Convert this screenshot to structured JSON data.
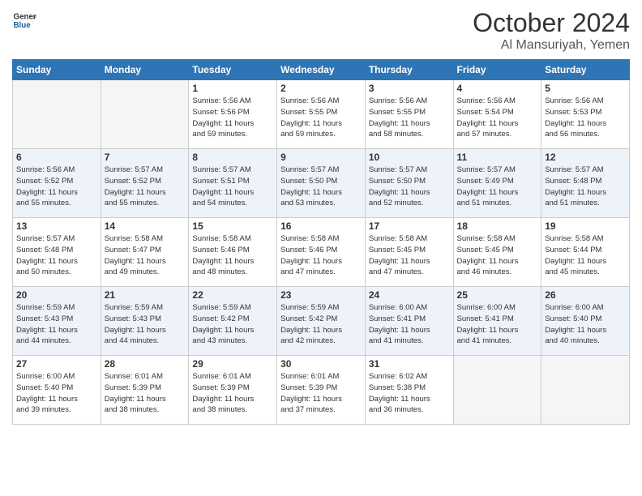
{
  "header": {
    "logo_line1": "General",
    "logo_line2": "Blue",
    "month": "October 2024",
    "location": "Al Mansuriyah, Yemen"
  },
  "weekdays": [
    "Sunday",
    "Monday",
    "Tuesday",
    "Wednesday",
    "Thursday",
    "Friday",
    "Saturday"
  ],
  "weeks": [
    [
      {
        "day": "",
        "info": ""
      },
      {
        "day": "",
        "info": ""
      },
      {
        "day": "1",
        "info": "Sunrise: 5:56 AM\nSunset: 5:56 PM\nDaylight: 11 hours\nand 59 minutes."
      },
      {
        "day": "2",
        "info": "Sunrise: 5:56 AM\nSunset: 5:55 PM\nDaylight: 11 hours\nand 59 minutes."
      },
      {
        "day": "3",
        "info": "Sunrise: 5:56 AM\nSunset: 5:55 PM\nDaylight: 11 hours\nand 58 minutes."
      },
      {
        "day": "4",
        "info": "Sunrise: 5:56 AM\nSunset: 5:54 PM\nDaylight: 11 hours\nand 57 minutes."
      },
      {
        "day": "5",
        "info": "Sunrise: 5:56 AM\nSunset: 5:53 PM\nDaylight: 11 hours\nand 56 minutes."
      }
    ],
    [
      {
        "day": "6",
        "info": "Sunrise: 5:56 AM\nSunset: 5:52 PM\nDaylight: 11 hours\nand 55 minutes."
      },
      {
        "day": "7",
        "info": "Sunrise: 5:57 AM\nSunset: 5:52 PM\nDaylight: 11 hours\nand 55 minutes."
      },
      {
        "day": "8",
        "info": "Sunrise: 5:57 AM\nSunset: 5:51 PM\nDaylight: 11 hours\nand 54 minutes."
      },
      {
        "day": "9",
        "info": "Sunrise: 5:57 AM\nSunset: 5:50 PM\nDaylight: 11 hours\nand 53 minutes."
      },
      {
        "day": "10",
        "info": "Sunrise: 5:57 AM\nSunset: 5:50 PM\nDaylight: 11 hours\nand 52 minutes."
      },
      {
        "day": "11",
        "info": "Sunrise: 5:57 AM\nSunset: 5:49 PM\nDaylight: 11 hours\nand 51 minutes."
      },
      {
        "day": "12",
        "info": "Sunrise: 5:57 AM\nSunset: 5:48 PM\nDaylight: 11 hours\nand 51 minutes."
      }
    ],
    [
      {
        "day": "13",
        "info": "Sunrise: 5:57 AM\nSunset: 5:48 PM\nDaylight: 11 hours\nand 50 minutes."
      },
      {
        "day": "14",
        "info": "Sunrise: 5:58 AM\nSunset: 5:47 PM\nDaylight: 11 hours\nand 49 minutes."
      },
      {
        "day": "15",
        "info": "Sunrise: 5:58 AM\nSunset: 5:46 PM\nDaylight: 11 hours\nand 48 minutes."
      },
      {
        "day": "16",
        "info": "Sunrise: 5:58 AM\nSunset: 5:46 PM\nDaylight: 11 hours\nand 47 minutes."
      },
      {
        "day": "17",
        "info": "Sunrise: 5:58 AM\nSunset: 5:45 PM\nDaylight: 11 hours\nand 47 minutes."
      },
      {
        "day": "18",
        "info": "Sunrise: 5:58 AM\nSunset: 5:45 PM\nDaylight: 11 hours\nand 46 minutes."
      },
      {
        "day": "19",
        "info": "Sunrise: 5:58 AM\nSunset: 5:44 PM\nDaylight: 11 hours\nand 45 minutes."
      }
    ],
    [
      {
        "day": "20",
        "info": "Sunrise: 5:59 AM\nSunset: 5:43 PM\nDaylight: 11 hours\nand 44 minutes."
      },
      {
        "day": "21",
        "info": "Sunrise: 5:59 AM\nSunset: 5:43 PM\nDaylight: 11 hours\nand 44 minutes."
      },
      {
        "day": "22",
        "info": "Sunrise: 5:59 AM\nSunset: 5:42 PM\nDaylight: 11 hours\nand 43 minutes."
      },
      {
        "day": "23",
        "info": "Sunrise: 5:59 AM\nSunset: 5:42 PM\nDaylight: 11 hours\nand 42 minutes."
      },
      {
        "day": "24",
        "info": "Sunrise: 6:00 AM\nSunset: 5:41 PM\nDaylight: 11 hours\nand 41 minutes."
      },
      {
        "day": "25",
        "info": "Sunrise: 6:00 AM\nSunset: 5:41 PM\nDaylight: 11 hours\nand 41 minutes."
      },
      {
        "day": "26",
        "info": "Sunrise: 6:00 AM\nSunset: 5:40 PM\nDaylight: 11 hours\nand 40 minutes."
      }
    ],
    [
      {
        "day": "27",
        "info": "Sunrise: 6:00 AM\nSunset: 5:40 PM\nDaylight: 11 hours\nand 39 minutes."
      },
      {
        "day": "28",
        "info": "Sunrise: 6:01 AM\nSunset: 5:39 PM\nDaylight: 11 hours\nand 38 minutes."
      },
      {
        "day": "29",
        "info": "Sunrise: 6:01 AM\nSunset: 5:39 PM\nDaylight: 11 hours\nand 38 minutes."
      },
      {
        "day": "30",
        "info": "Sunrise: 6:01 AM\nSunset: 5:39 PM\nDaylight: 11 hours\nand 37 minutes."
      },
      {
        "day": "31",
        "info": "Sunrise: 6:02 AM\nSunset: 5:38 PM\nDaylight: 11 hours\nand 36 minutes."
      },
      {
        "day": "",
        "info": ""
      },
      {
        "day": "",
        "info": ""
      }
    ]
  ]
}
